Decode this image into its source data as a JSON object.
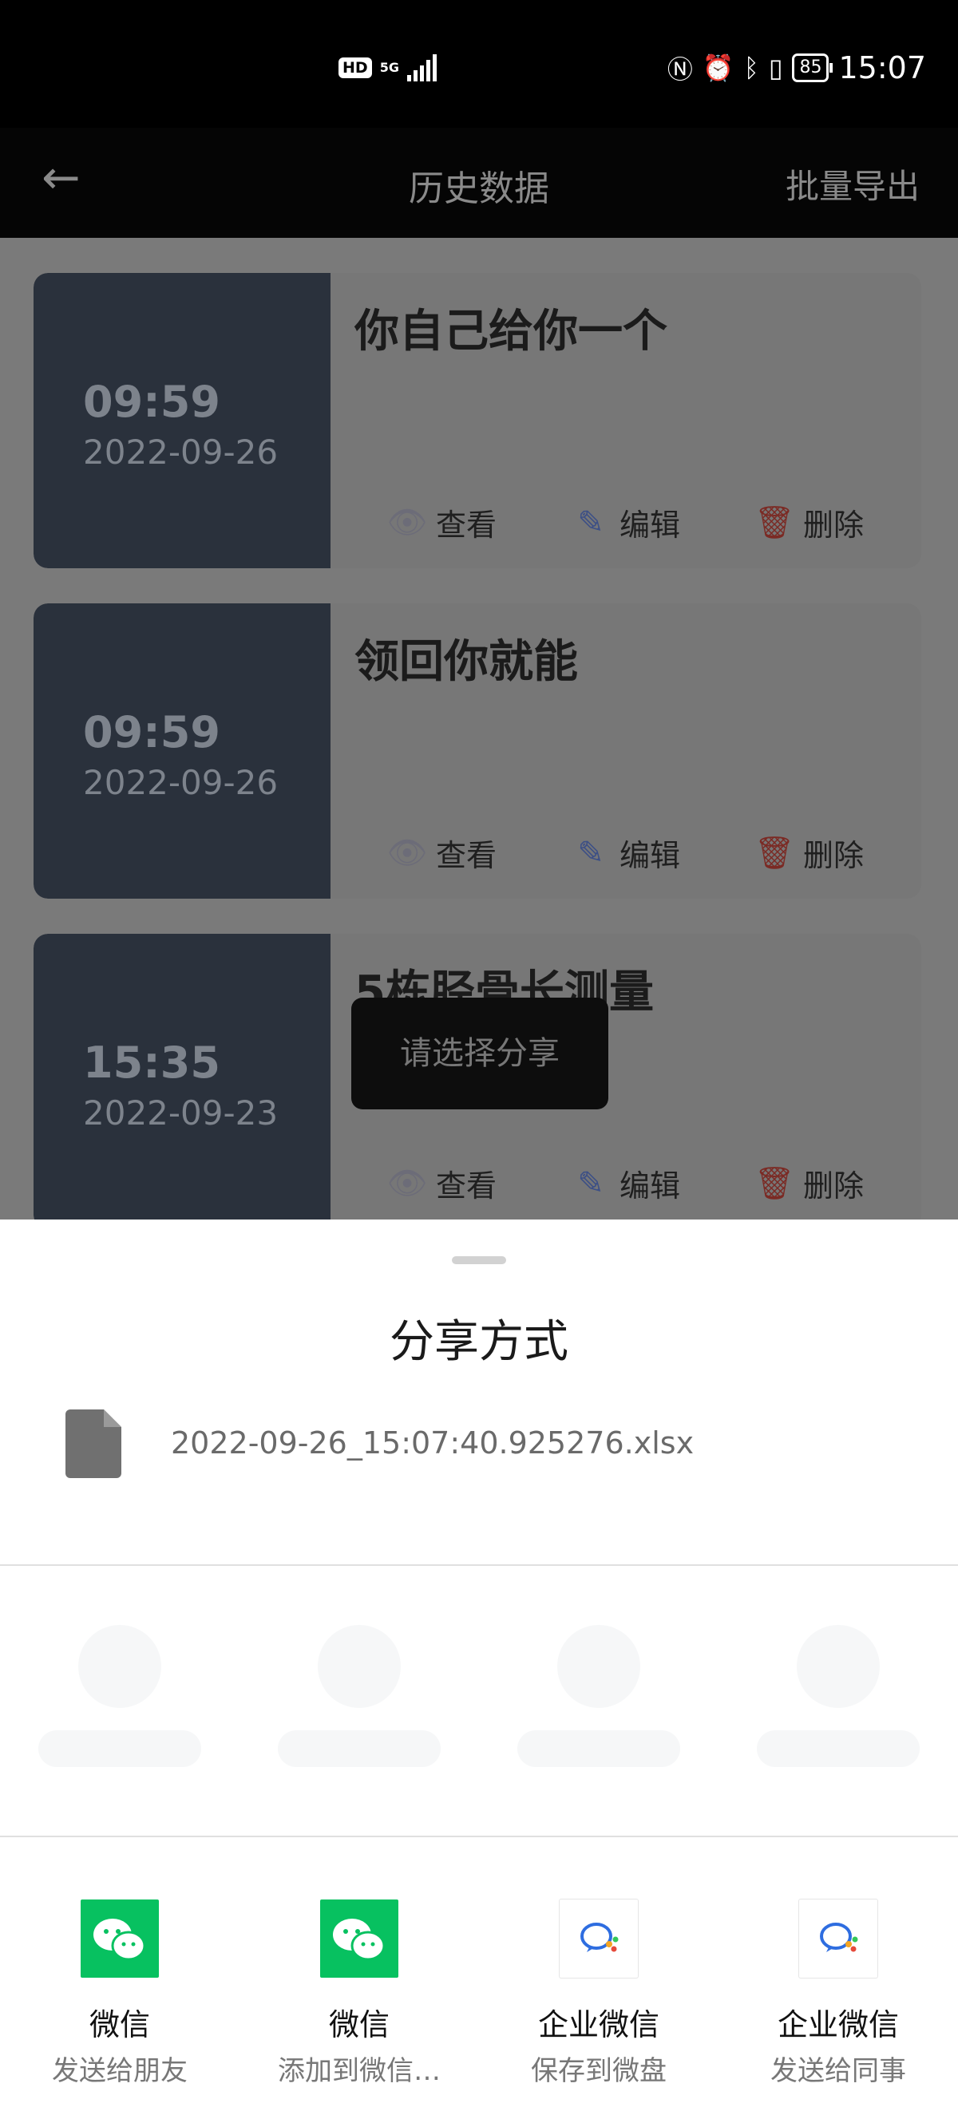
{
  "status_bar": {
    "hd": "HD",
    "network": "5G",
    "battery": "85",
    "time": "15:07",
    "icons": [
      "nfc-icon",
      "alarm-icon",
      "bluetooth-icon",
      "vibrate-icon"
    ]
  },
  "app_bar": {
    "title": "历史数据",
    "action": "批量导出",
    "back_icon": "arrow-left-icon"
  },
  "records": [
    {
      "time": "09:59",
      "date": "2022-09-26",
      "title": "你自己给你一个"
    },
    {
      "time": "09:59",
      "date": "2022-09-26",
      "title": "领回你就能"
    },
    {
      "time": "15:35",
      "date": "2022-09-23",
      "title": "5栋胫骨长测量"
    }
  ],
  "actions": {
    "view": "查看",
    "edit": "编辑",
    "delete": "删除"
  },
  "toast": "请选择分享",
  "share_sheet": {
    "title": "分享方式",
    "file_name": "2022-09-26_15:07:40.925276.xlsx",
    "apps": [
      {
        "name": "微信",
        "desc": "发送给朋友",
        "icon": "wechat-icon",
        "color": "#07c160"
      },
      {
        "name": "微信",
        "desc": "添加到微信…",
        "icon": "wechat-icon",
        "color": "#07c160"
      },
      {
        "name": "企业微信",
        "desc": "保存到微盘",
        "icon": "wecom-icon",
        "color": "#2e6de0"
      },
      {
        "name": "企业微信",
        "desc": "发送给同事",
        "icon": "wecom-icon",
        "color": "#2e6de0"
      }
    ]
  }
}
